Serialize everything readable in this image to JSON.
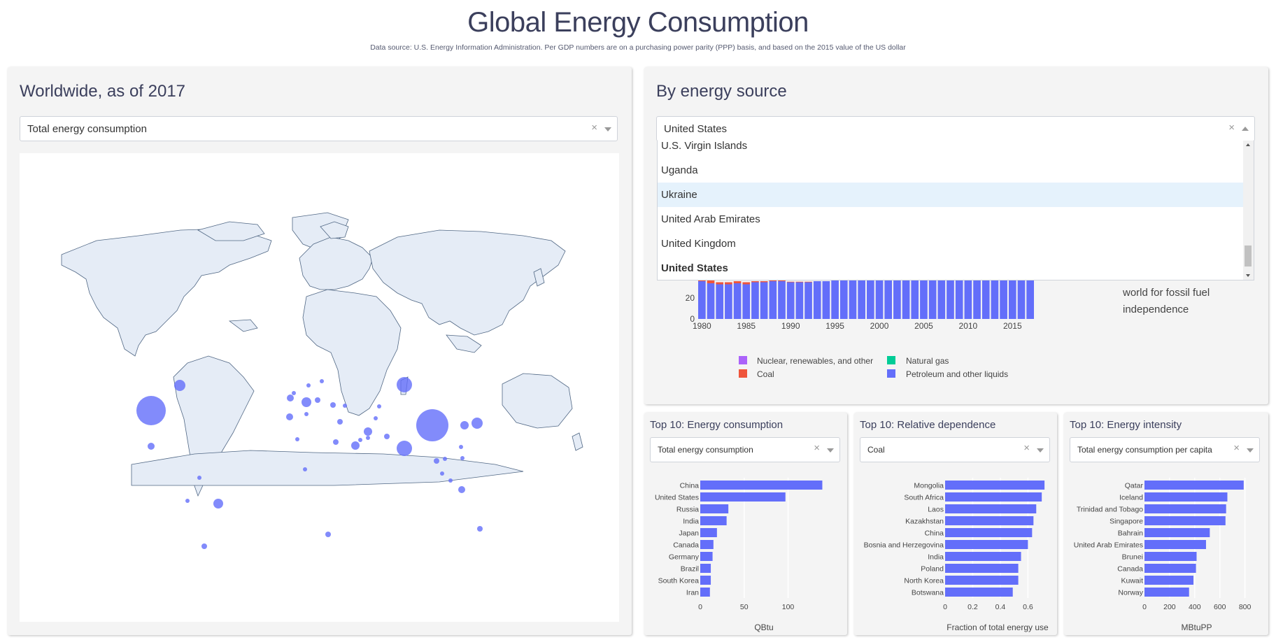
{
  "header": {
    "title": "Global Energy Consumption",
    "subtitle": "Data source: U.S. Energy Information Administration. Per GDP numbers are on a purchasing power parity (PPP) basis, and based on the 2015 value of the US dollar"
  },
  "worldwide": {
    "title": "Worldwide, as of 2017",
    "select_value": "Total energy consumption"
  },
  "by_source": {
    "title": "By energy source",
    "select_value": "United States",
    "dropdown_options": [
      "U.S. Virgin Islands",
      "Uganda",
      "Ukraine",
      "United Arab Emirates",
      "United Kingdom",
      "United States"
    ],
    "side_text": "world for fossil fuel independence",
    "legend": [
      "Nuclear, renewables, and other",
      "Natural gas",
      "Coal",
      "Petroleum and other liquids"
    ],
    "colors": {
      "nuclear": "#ab63fa",
      "gas": "#00cc96",
      "coal": "#ef553b",
      "petroleum": "#636efa"
    }
  },
  "top_consumption": {
    "title": "Top 10: Energy consumption",
    "select_value": "Total energy consumption",
    "xlabel": "QBtu"
  },
  "top_dependence": {
    "title": "Top 10: Relative dependence",
    "select_value": "Coal",
    "xlabel": "Fraction of total energy use"
  },
  "top_intensity": {
    "title": "Top 10: Energy intensity",
    "select_value": "Total energy consumption per capita",
    "xlabel": "MBtuPP"
  },
  "chart_data": [
    {
      "type": "bar",
      "title": "By energy source (United States, stacked)",
      "categories": [
        1980,
        1981,
        1982,
        1983,
        1984,
        1985,
        1986,
        1987,
        1988,
        1989,
        1990,
        1991,
        1992,
        1993,
        1994,
        1995,
        1996,
        1997,
        1998,
        1999,
        2000,
        2001,
        2002,
        2003,
        2004,
        2005,
        2006,
        2007,
        2008,
        2009,
        2010,
        2011,
        2012,
        2013,
        2014,
        2015,
        2016,
        2017
      ],
      "series": [
        {
          "name": "Petroleum and other liquids",
          "values": [
            36,
            34,
            33,
            33,
            34,
            33,
            35,
            35,
            36,
            36,
            35,
            35,
            35,
            36,
            36,
            37,
            38,
            38,
            38,
            39,
            40,
            40,
            40,
            40,
            41,
            41,
            41,
            41,
            39,
            38,
            38,
            38,
            37,
            37,
            37,
            37,
            37,
            37
          ]
        },
        {
          "name": "Coal",
          "values": [
            3,
            3,
            2,
            2,
            2,
            2,
            1,
            1,
            1,
            1,
            0.5,
            0.5,
            0.5,
            0,
            0,
            0,
            0,
            0,
            0,
            0,
            0,
            0,
            0,
            0,
            0,
            0,
            0,
            0,
            0,
            0,
            0,
            0,
            0,
            0,
            0,
            0,
            0,
            0
          ]
        }
      ],
      "x_ticks": [
        1980,
        1985,
        1990,
        1995,
        2000,
        2005,
        2010,
        2015
      ],
      "y_ticks": [
        0,
        20
      ]
    },
    {
      "type": "bar",
      "title": "Top 10: Energy consumption",
      "categories": [
        "China",
        "United States",
        "Russia",
        "India",
        "Japan",
        "Canada",
        "Germany",
        "Brazil",
        "South Korea",
        "Iran"
      ],
      "values": [
        139,
        97,
        32,
        30,
        19,
        15,
        14,
        12,
        12,
        11
      ],
      "xlabel": "QBtu",
      "x_ticks": [
        0,
        50,
        100
      ],
      "xlim": [
        0,
        145
      ]
    },
    {
      "type": "bar",
      "title": "Top 10: Relative dependence",
      "categories": [
        "Mongolia",
        "South Africa",
        "Laos",
        "Kazakhstan",
        "China",
        "Bosnia and Herzegovina",
        "India",
        "Poland",
        "North Korea",
        "Botswana"
      ],
      "values": [
        0.72,
        0.7,
        0.66,
        0.64,
        0.63,
        0.6,
        0.55,
        0.53,
        0.53,
        0.49
      ],
      "xlabel": "Fraction of total energy use",
      "x_ticks": [
        0,
        0.2,
        0.4,
        0.6
      ],
      "xlim": [
        0,
        0.76
      ]
    },
    {
      "type": "bar",
      "title": "Top 10: Energy intensity",
      "categories": [
        "Qatar",
        "Iceland",
        "Trinidad and Tobago",
        "Singapore",
        "Bahrain",
        "United Arab Emirates",
        "Brunei",
        "Canada",
        "Kuwait",
        "Norway"
      ],
      "values": [
        790,
        660,
        650,
        645,
        520,
        490,
        415,
        410,
        390,
        355
      ],
      "xlabel": "MBtuPP",
      "x_ticks": [
        0,
        200,
        400,
        600,
        800
      ],
      "xlim": [
        0,
        830
      ]
    }
  ]
}
